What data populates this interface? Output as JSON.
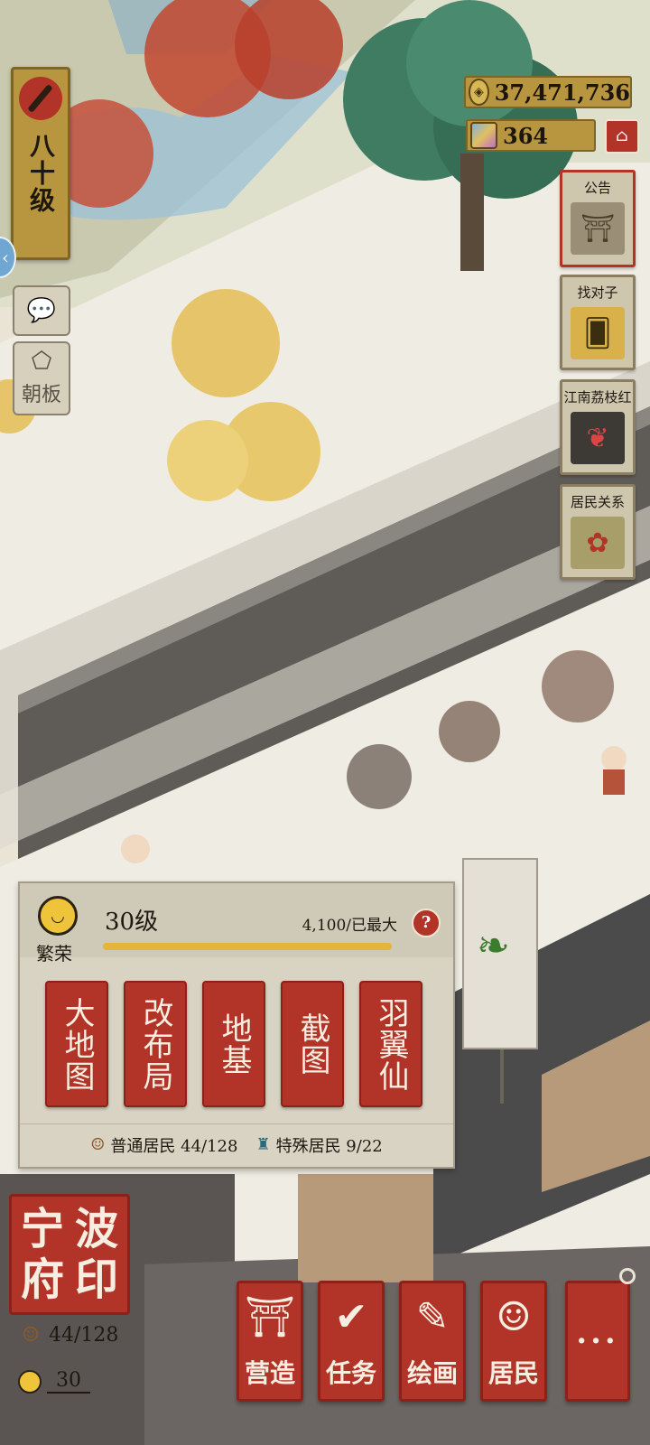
{
  "player": {
    "level_label": "八十级",
    "level_icon": "brush-icon"
  },
  "side_buttons": [
    {
      "icon": "chat-icon",
      "label": ""
    },
    {
      "icon": "court-board-icon",
      "label": "朝板"
    }
  ],
  "currency": {
    "coins": "37,471,736",
    "coins_icon": "copper-coin-icon",
    "gems": "364",
    "gems_icon": "jade-icon",
    "shop_icon": "shop-icon"
  },
  "events": [
    {
      "name": "公告",
      "icon": "gate-icon"
    },
    {
      "name": "找对子",
      "icon": "match-cards-icon"
    },
    {
      "name": "江南荔枝红",
      "icon": "litchi-icon"
    },
    {
      "name": "居民关系",
      "icon": "knot-icon"
    }
  ],
  "prosperity": {
    "label": "繁荣",
    "level": "30级",
    "value_text": "4,100/已最大",
    "progress": 1.0,
    "help_label": "?",
    "actions": [
      {
        "label": "大地图"
      },
      {
        "label": "改布局"
      },
      {
        "label": "地基"
      },
      {
        "label": "截图"
      },
      {
        "label": "羽翼仙"
      }
    ],
    "common_residents": "普通居民 44/128",
    "special_residents": "特殊居民 9/22"
  },
  "city": {
    "seal_chars": [
      "宁",
      "波",
      "府",
      "印"
    ],
    "population": "44/128",
    "prosperity_level": "30"
  },
  "bottom_menu": [
    {
      "label": "营造",
      "icon": "building-icon"
    },
    {
      "label": "任务",
      "icon": "task-book-icon"
    },
    {
      "label": "绘画",
      "icon": "scroll-icon"
    },
    {
      "label": "居民",
      "icon": "resident-icon"
    },
    {
      "label": "···",
      "icon": "more-icon"
    }
  ],
  "colors": {
    "accent_red": "#b23328",
    "gold": "#b8953f",
    "progress_yellow": "#e3b53b",
    "paper": "#e9e4d6"
  }
}
